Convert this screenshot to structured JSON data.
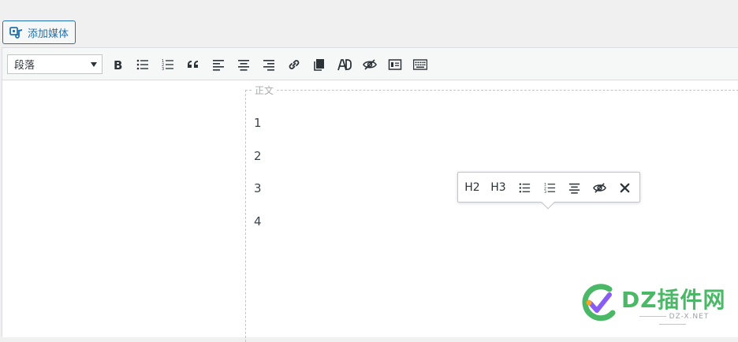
{
  "header": {
    "add_media_label": "添加媒体"
  },
  "toolbar": {
    "format_value": "段落",
    "buttons": [
      {
        "name": "bold-icon"
      },
      {
        "name": "bullet-list-icon"
      },
      {
        "name": "numbered-list-icon"
      },
      {
        "name": "blockquote-icon"
      },
      {
        "name": "align-left-icon"
      },
      {
        "name": "align-center-icon"
      },
      {
        "name": "align-right-icon"
      },
      {
        "name": "link-icon"
      },
      {
        "name": "copy-icon"
      },
      {
        "name": "ad-icon"
      },
      {
        "name": "hide-icon"
      },
      {
        "name": "frame-icon"
      },
      {
        "name": "keyboard-icon"
      }
    ]
  },
  "editor": {
    "block_label": "正文",
    "lines": [
      "1",
      "2",
      "3",
      "4"
    ]
  },
  "inline_toolbar": {
    "h2_label": "H2",
    "h3_label": "H3"
  },
  "watermark": {
    "brand": "DZ插件网",
    "domain": "DZ-X.NET",
    "colors": {
      "green": "#4ab866",
      "purple": "#8a5cf6",
      "orange": "#f5a623"
    }
  }
}
